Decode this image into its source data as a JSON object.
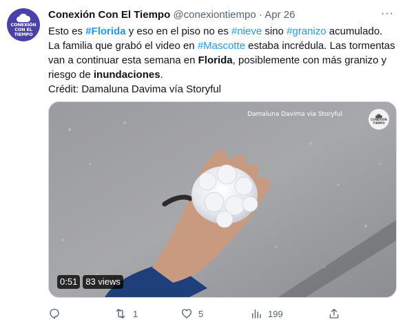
{
  "author": {
    "display_name": "Conexión Con El Tiempo",
    "handle": "@conexiontiempo",
    "separator": "·",
    "date": "Apr 26",
    "avatar_logo_text": "CONEXIÓN CON EL TIEMPO"
  },
  "more_menu": "···",
  "tweet": {
    "t1": "Esto es ",
    "h1": "#Florida",
    "t2": " y eso en el piso no es ",
    "h2": "#nieve",
    "t3": " sino ",
    "h3": "#granizo",
    "t4": " acumulado. La familia que grabó el video en ",
    "h4": "#Mascotte",
    "t5": " estaba incrédula. Las tormentas van a continuar esta semana en ",
    "b1": "Florida",
    "t6": ", posiblemente con más granizo y riesgo de ",
    "b2": "inundaciones",
    "t7": ".",
    "credit": "Crédit: Damaluna Davima vía Storyful"
  },
  "media": {
    "watermark": "Damaluna Davima via Storyful",
    "logo_text": "CONEXIÓN TIEMPO",
    "duration": "0:51",
    "views": "83 views"
  },
  "actions": {
    "reply_count": "",
    "retweet_count": "1",
    "like_count": "5",
    "view_count": "199"
  },
  "colors": {
    "accent": "#1d9bf0",
    "muted": "#536471",
    "avatar_bg": "#4b3fa8"
  }
}
